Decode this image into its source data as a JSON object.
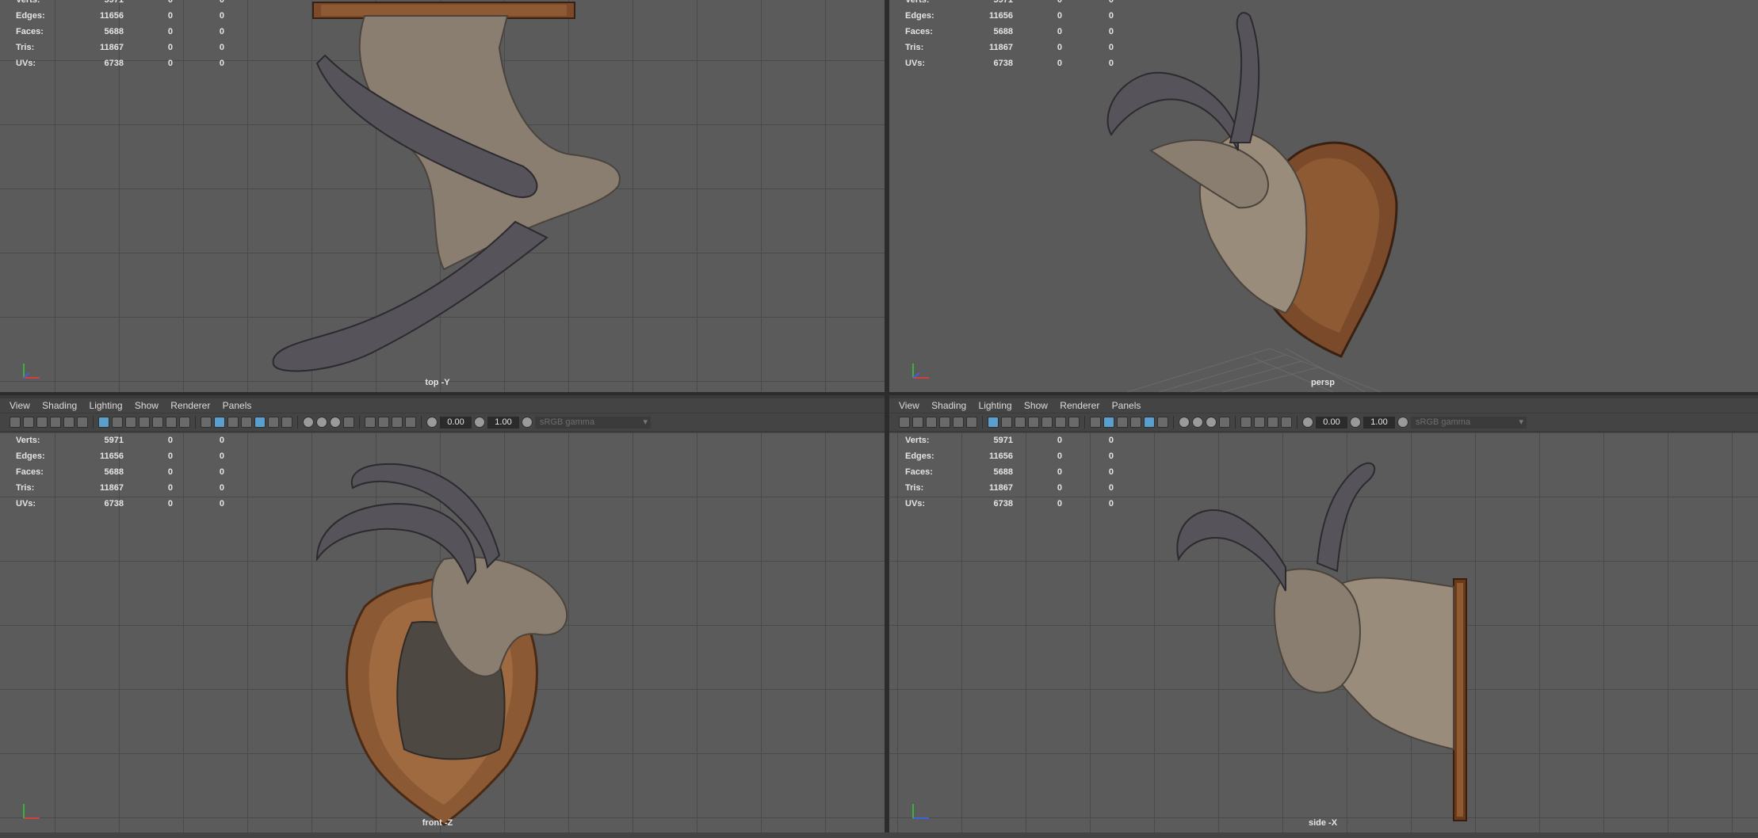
{
  "menu": [
    "View",
    "Shading",
    "Lighting",
    "Show",
    "Renderer",
    "Panels"
  ],
  "toolbar": {
    "exposure": "0.00",
    "gamma": "1.00",
    "color_space": "sRGB gamma"
  },
  "hud": {
    "rows": [
      {
        "label": "Verts:",
        "v1": "5971",
        "v2": "0",
        "v3": "0"
      },
      {
        "label": "Edges:",
        "v1": "11656",
        "v2": "0",
        "v3": "0"
      },
      {
        "label": "Faces:",
        "v1": "5688",
        "v2": "0",
        "v3": "0"
      },
      {
        "label": "Tris:",
        "v1": "11867",
        "v2": "0",
        "v3": "0"
      },
      {
        "label": "UVs:",
        "v1": "6738",
        "v2": "0",
        "v3": "0"
      }
    ]
  },
  "viewports": {
    "top": {
      "label": "top -Y"
    },
    "persp": {
      "label": "persp"
    },
    "front": {
      "label": "front -Z"
    },
    "side": {
      "label": "side -X"
    }
  },
  "colors": {
    "viewport_bg": "#5b5b5b",
    "grid": "#4a4a4a",
    "panel": "#444444",
    "accent": "#5b9fcf",
    "wood": "#7a4a2a",
    "fur": "#8a7e70",
    "horn": "#56535a"
  }
}
